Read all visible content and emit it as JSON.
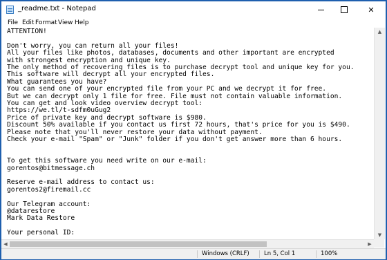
{
  "window": {
    "title": "_readme.txt - Notepad",
    "buttons": {
      "close": "✕"
    }
  },
  "menu": [
    "File",
    "Edit",
    "Format",
    "View",
    "Help"
  ],
  "lines": [
    "ATTENTION!",
    "",
    "Don't worry, you can return all your files!",
    "All your files like photos, databases, documents and other important are encrypted",
    "with strongest encryption and unique key.",
    "The only method of recovering files is to purchase decrypt tool and unique key for you.",
    "This software will decrypt all your encrypted files.",
    "What guarantees you have?",
    "You can send one of your encrypted file from your PC and we decrypt it for free.",
    "But we can decrypt only 1 file for free. File must not contain valuable information.",
    "You can get and look video overview decrypt tool:",
    "https://we.tl/t-sdfm0uGug2",
    "Price of private key and decrypt software is $980.",
    "Discount 50% available if you contact us first 72 hours, that's price for you is $490.",
    "Please note that you'll never restore your data without payment.",
    "Check your e-mail \"Spam\" or \"Junk\" folder if you don't get answer more than 6 hours.",
    "",
    "",
    "To get this software you need write on our e-mail:",
    "gorentos@bitmessage.ch",
    "",
    "Reserve e-mail address to contact us:",
    "gorentos2@firemail.cc",
    "",
    "Our Telegram account:",
    "@datarestore",
    "Mark Data Restore",
    "",
    "Your personal ID:",
    "-"
  ],
  "scrollbars": {
    "up": "▲",
    "down": "▼",
    "left": "◀",
    "right": "▶"
  },
  "status": {
    "line_ending": "Windows (CRLF)",
    "position": "Ln 5, Col 1",
    "zoom": "100%"
  }
}
